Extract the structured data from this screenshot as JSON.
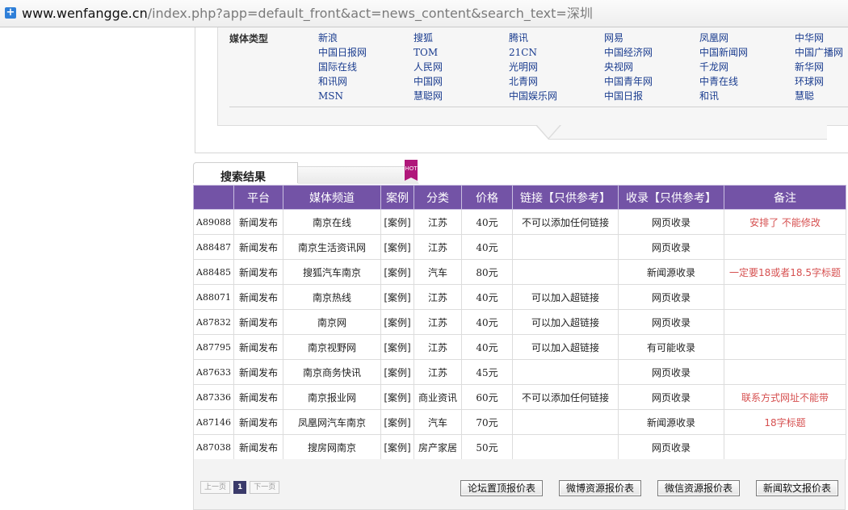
{
  "browser": {
    "url_domain": "www.wenfangge.cn",
    "url_rest": "/index.php?app=default_front&act=news_content&search_text=深圳",
    "icon": "plus-icon"
  },
  "media_types": {
    "label": "媒体类型",
    "rows": [
      [
        "新浪",
        "搜狐",
        "腾讯",
        "网易",
        "凤凰网",
        "中华网"
      ],
      [
        "中国日报网",
        "TOM",
        "21CN",
        "中国经济网",
        "中国新闻网",
        "中国广播网"
      ],
      [
        "国际在线",
        "人民网",
        "光明网",
        "央视网",
        "千龙网",
        "新华网"
      ],
      [
        "和讯网",
        "中国网",
        "北青网",
        "中国青年网",
        "中青在线",
        "环球网"
      ],
      [
        "MSN",
        "慧聪网",
        "中国娱乐网",
        "中国日报",
        "和讯",
        "慧聪"
      ]
    ]
  },
  "results": {
    "tab_title": "搜索结果",
    "hot_badge": "HOT",
    "headers": [
      "",
      "平台",
      "媒体频道",
      "案例",
      "分类",
      "价格",
      "链接【只供参考】",
      "收录【只供参考】",
      "备注"
    ],
    "rows": [
      {
        "code": "A89088",
        "platform": "新闻发布",
        "channel": "南京在线",
        "case": "[案例]",
        "category": "江苏",
        "price": "40元",
        "link": "不可以添加任何链接",
        "index": "网页收录",
        "note": "安排了 不能修改"
      },
      {
        "code": "A88487",
        "platform": "新闻发布",
        "channel": "南京生活资讯网",
        "case": "[案例]",
        "category": "江苏",
        "price": "40元",
        "link": "",
        "index": "网页收录",
        "note": ""
      },
      {
        "code": "A88485",
        "platform": "新闻发布",
        "channel": "搜狐汽车南京",
        "case": "[案例]",
        "category": "汽车",
        "price": "80元",
        "link": "",
        "index": "新闻源收录",
        "note": "一定要18或者18.5字标题"
      },
      {
        "code": "A88071",
        "platform": "新闻发布",
        "channel": "南京热线",
        "case": "[案例]",
        "category": "江苏",
        "price": "40元",
        "link": "可以加入超链接",
        "index": "网页收录",
        "note": ""
      },
      {
        "code": "A87832",
        "platform": "新闻发布",
        "channel": "南京网",
        "case": "[案例]",
        "category": "江苏",
        "price": "40元",
        "link": "可以加入超链接",
        "index": "网页收录",
        "note": ""
      },
      {
        "code": "A87795",
        "platform": "新闻发布",
        "channel": "南京视野网",
        "case": "[案例]",
        "category": "江苏",
        "price": "40元",
        "link": "可以加入超链接",
        "index": "有可能收录",
        "note": ""
      },
      {
        "code": "A87633",
        "platform": "新闻发布",
        "channel": "南京商务快讯",
        "case": "[案例]",
        "category": "江苏",
        "price": "45元",
        "link": "",
        "index": "网页收录",
        "note": ""
      },
      {
        "code": "A87336",
        "platform": "新闻发布",
        "channel": "南京报业网",
        "case": "[案例]",
        "category": "商业资讯",
        "price": "60元",
        "link": "不可以添加任何链接",
        "index": "网页收录",
        "note": "联系方式网址不能带"
      },
      {
        "code": "A87146",
        "platform": "新闻发布",
        "channel": "凤凰网汽车南京",
        "case": "[案例]",
        "category": "汽车",
        "price": "70元",
        "link": "",
        "index": "新闻源收录",
        "note": "18字标题"
      },
      {
        "code": "A87038",
        "platform": "新闻发布",
        "channel": "搜房网南京",
        "case": "[案例]",
        "category": "房产家居",
        "price": "50元",
        "link": "",
        "index": "网页收录",
        "note": ""
      }
    ]
  },
  "pager": {
    "prev": "上一页",
    "current": "1",
    "next": "下一页"
  },
  "links": [
    "论坛置顶报价表",
    "微博资源报价表",
    "微信资源报价表",
    "新闻软文报价表"
  ],
  "colors": {
    "header_purple": "#7353a6",
    "note_red": "#d65050",
    "media_link": "#1a3c8f"
  }
}
